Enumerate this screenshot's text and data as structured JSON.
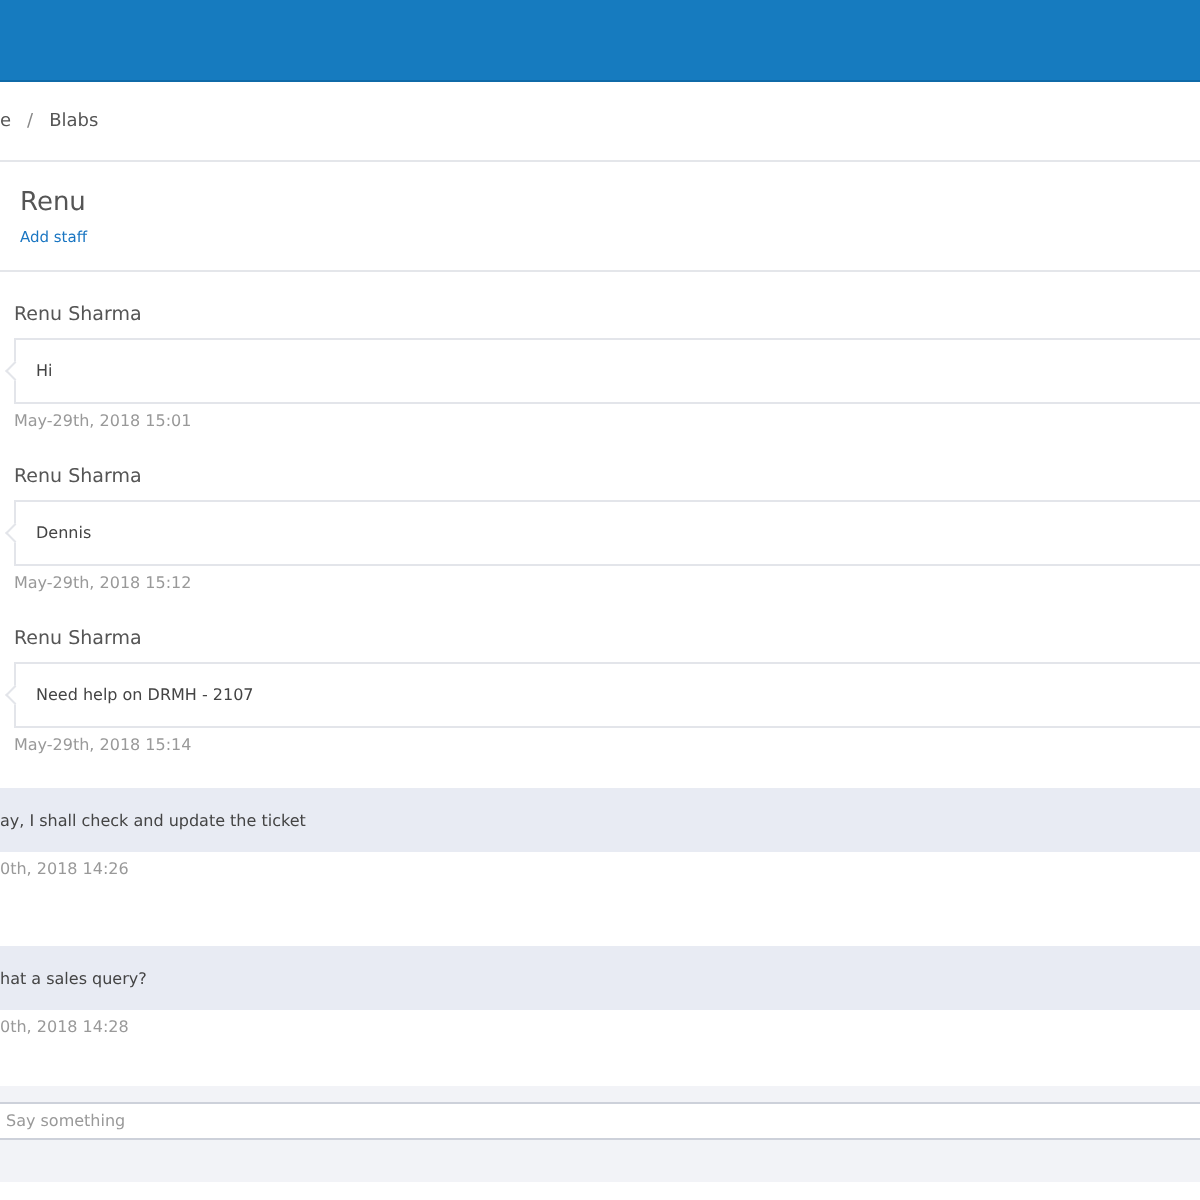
{
  "breadcrumb": {
    "items": [
      "e",
      "Blabs"
    ],
    "separator": "/"
  },
  "title": "Renu",
  "add_staff_link": "Add staff",
  "messages": [
    {
      "kind": "incoming",
      "sender": "Renu Sharma",
      "text": "Hi",
      "time": "May-29th, 2018 15:01"
    },
    {
      "kind": "incoming",
      "sender": "Renu Sharma",
      "text": "Dennis",
      "time": "May-29th, 2018 15:12"
    },
    {
      "kind": "incoming",
      "sender": "Renu Sharma",
      "text": "Need help on DRMH - 2107",
      "time": "May-29th, 2018 15:14"
    },
    {
      "kind": "outgoing",
      "text": "ay, I shall check and update the ticket",
      "time": "0th, 2018 14:26"
    },
    {
      "kind": "outgoing",
      "text": "hat a sales query?",
      "time": "0th, 2018 14:28"
    }
  ],
  "composer": {
    "placeholder": "Say something"
  }
}
